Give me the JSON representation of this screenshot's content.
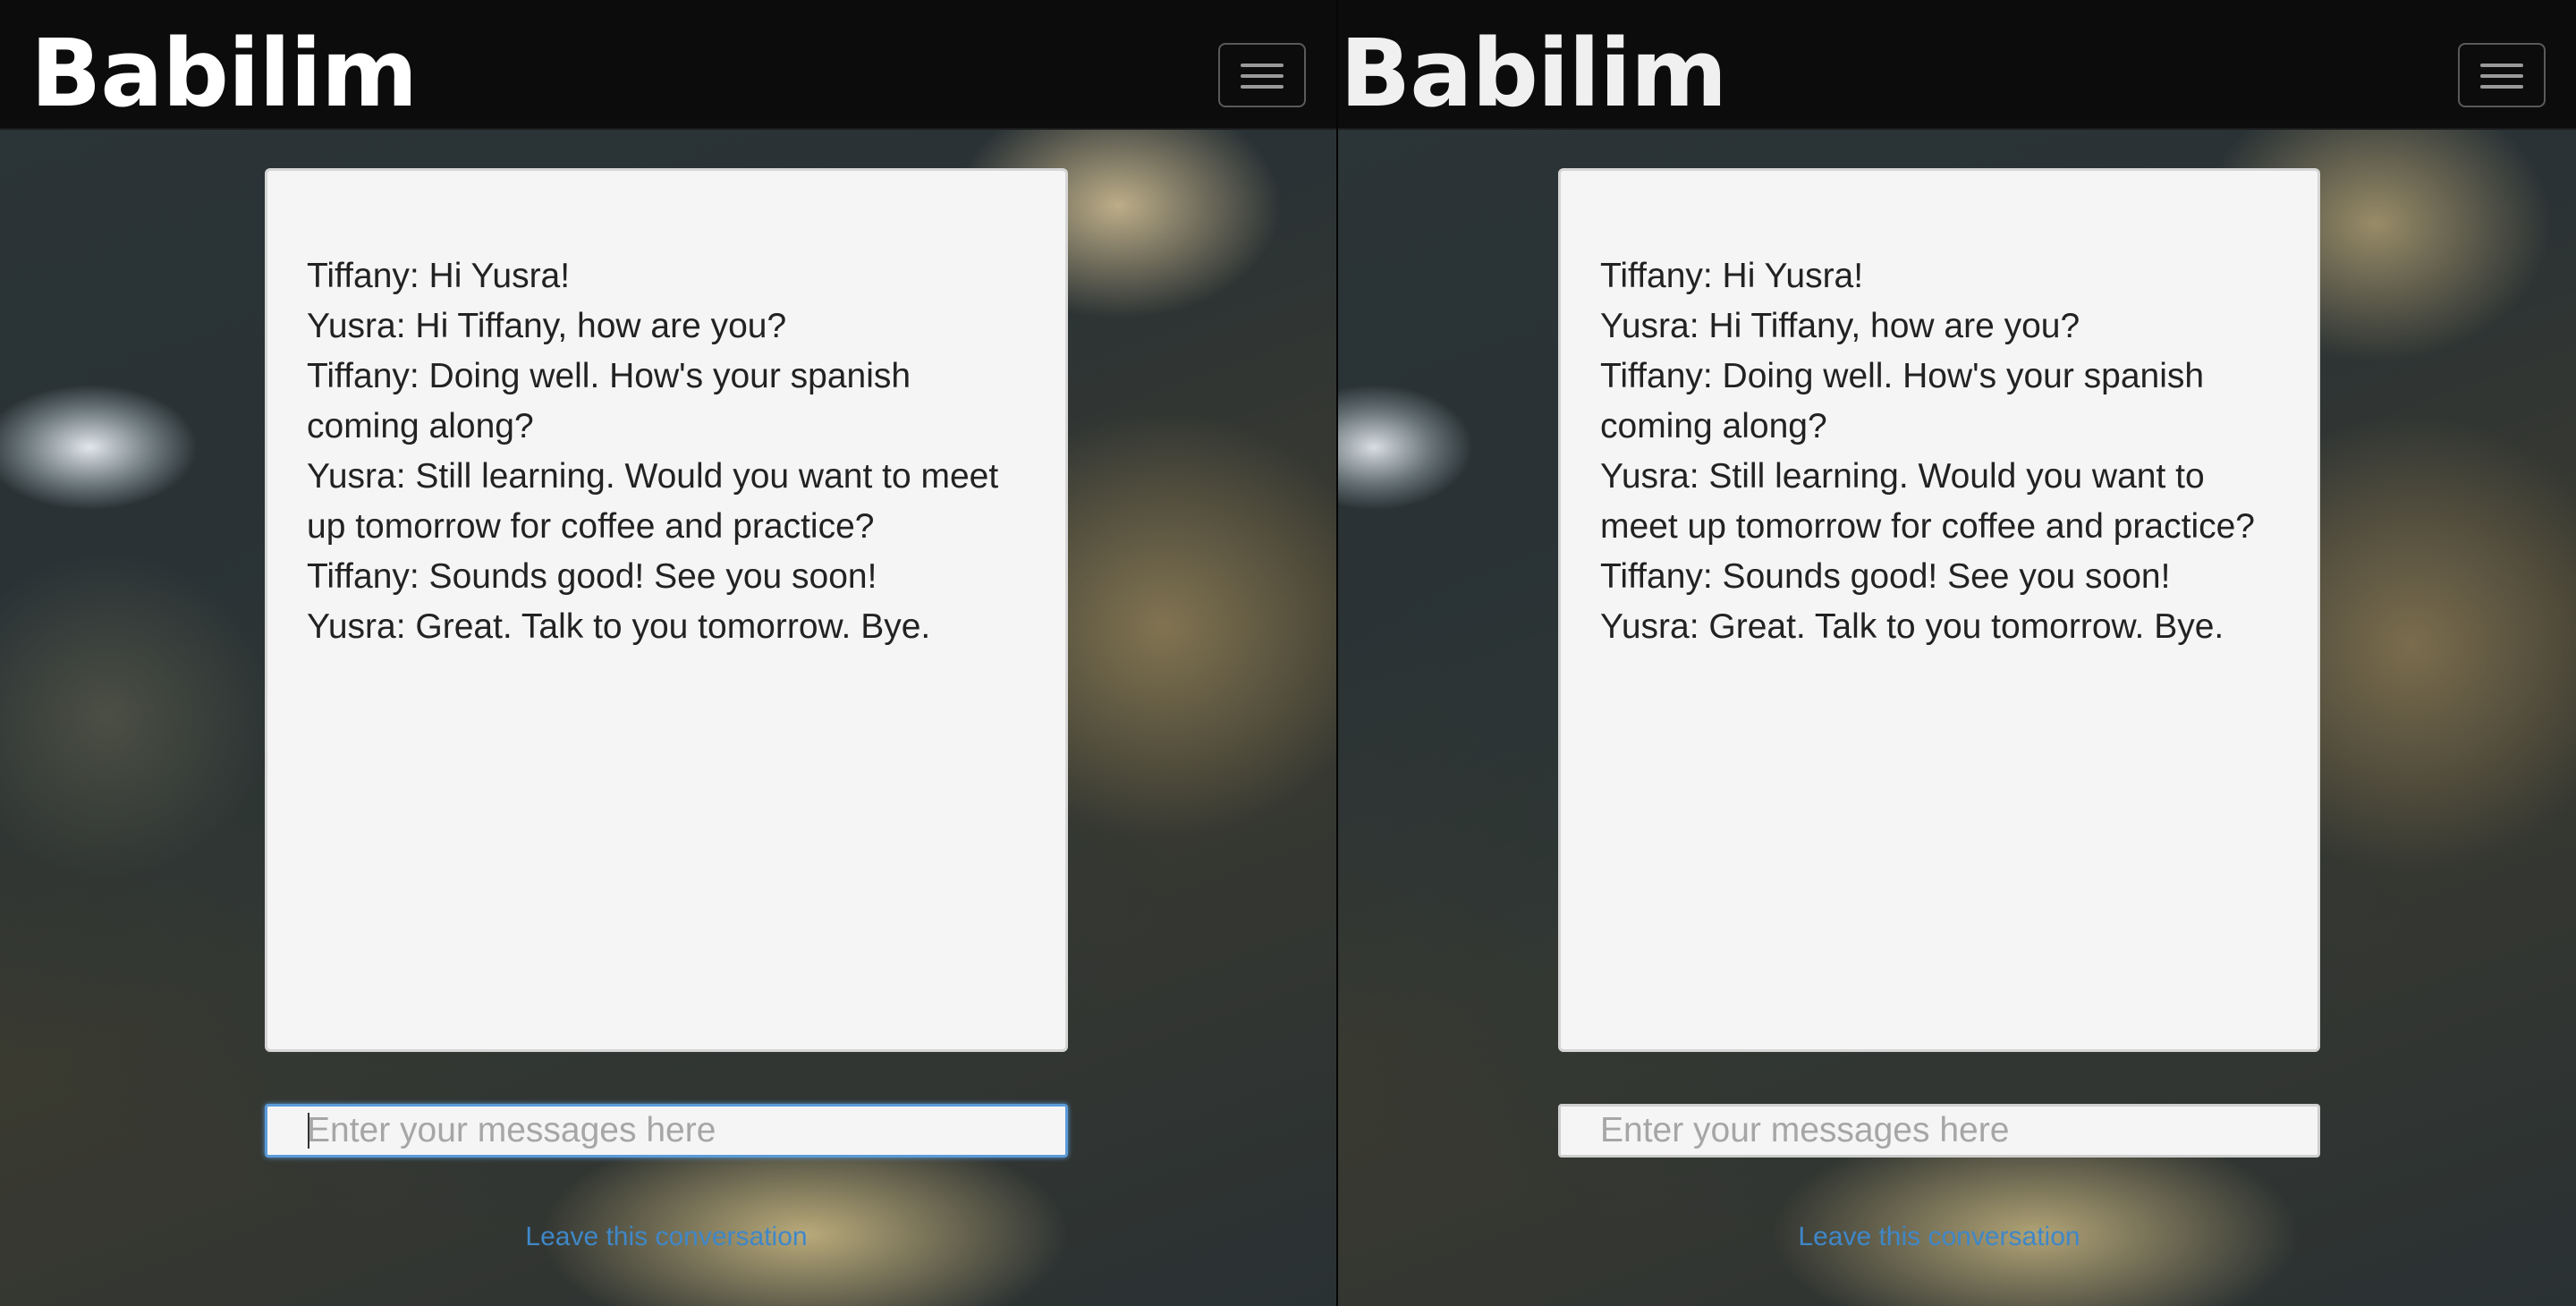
{
  "navbar": {
    "brand": "Babilim",
    "menu_icon": "hamburger-menu-icon"
  },
  "chat": {
    "messages": [
      "Tiffany: Hi Yusra!",
      "Yusra: Hi Tiffany, how are you?",
      "Tiffany: Doing well. How's your spanish coming along?",
      "Yusra: Still learning. Would you want to meet up tomorrow for coffee and practice?",
      "Tiffany: Sounds good! See you soon!",
      "Yusra: Great. Talk to you tomorrow. Bye."
    ]
  },
  "input": {
    "placeholder": "Enter your messages here",
    "value": ""
  },
  "leave_link": "Leave this conversation",
  "colors": {
    "navbar_bg": "#0c0c0c",
    "panel_bg": "#f5f5f5",
    "link": "#3f87c8",
    "focus_border": "#5b9bd8"
  }
}
